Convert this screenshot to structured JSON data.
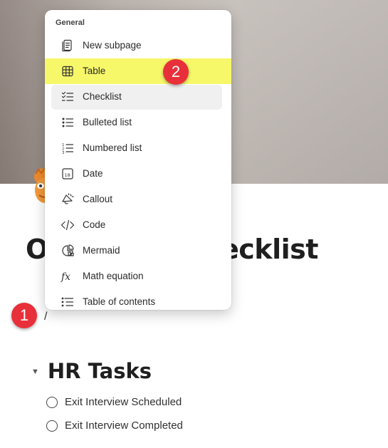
{
  "page": {
    "title_left": "O",
    "title_right": "ecklist",
    "slash_text": "/"
  },
  "menu": {
    "header": "General",
    "items": [
      {
        "label": "New subpage",
        "icon": "document-icon"
      },
      {
        "label": "Table",
        "icon": "table-icon"
      },
      {
        "label": "Checklist",
        "icon": "checklist-icon"
      },
      {
        "label": "Bulleted list",
        "icon": "bulleted-list-icon"
      },
      {
        "label": "Numbered list",
        "icon": "numbered-list-icon"
      },
      {
        "label": "Date",
        "icon": "calendar-icon"
      },
      {
        "label": "Callout",
        "icon": "megaphone-icon"
      },
      {
        "label": "Code",
        "icon": "code-icon"
      },
      {
        "label": "Mermaid",
        "icon": "diagram-icon"
      },
      {
        "label": "Math equation",
        "icon": "fx-icon"
      },
      {
        "label": "Table of contents",
        "icon": "toc-icon"
      }
    ]
  },
  "annotations": {
    "badge_1": "1",
    "badge_2": "2",
    "highlight_color": "#f7f76a",
    "badge_color": "#e8303a"
  },
  "section": {
    "heading": "HR Tasks",
    "tasks": [
      {
        "label": "Exit Interview Scheduled",
        "checked": false
      },
      {
        "label": "Exit Interview Completed",
        "checked": false
      }
    ]
  }
}
